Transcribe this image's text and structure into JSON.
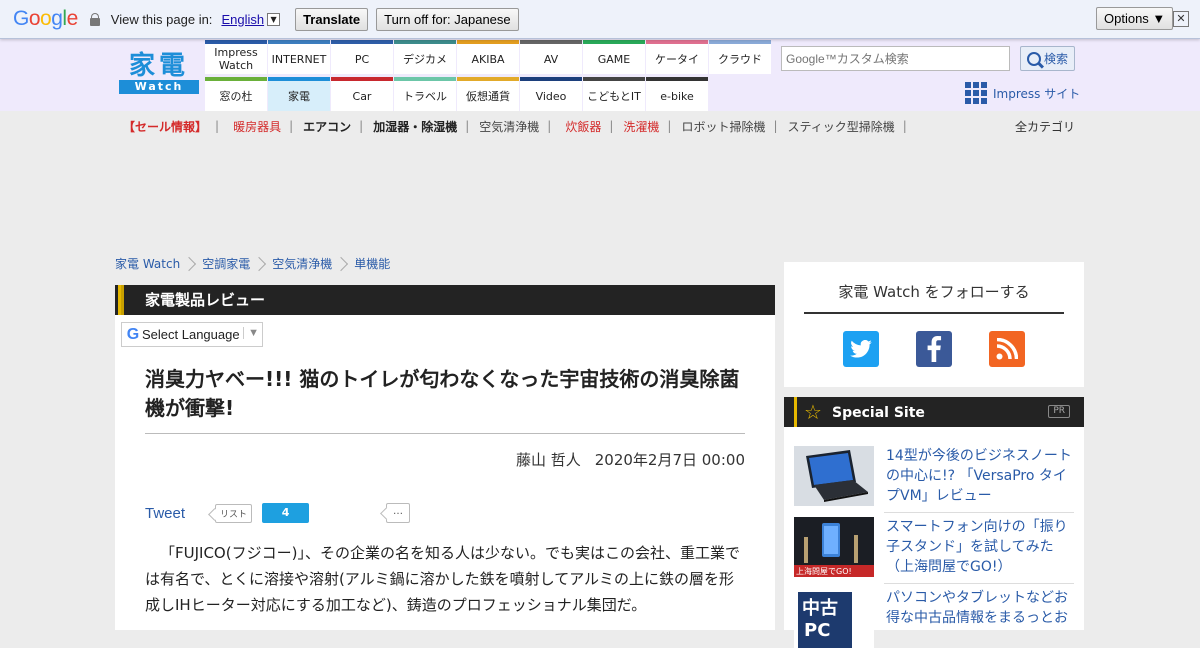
{
  "gtranslate": {
    "view_label": "View this page in:",
    "language": "English",
    "translate_btn": "Translate",
    "turnoff_btn": "Turn off for: Japanese",
    "options_btn": "Options ▼",
    "close": "✕"
  },
  "logo": {
    "kanji": "家電",
    "sub": "Watch"
  },
  "nav": {
    "top": [
      "Impress Watch",
      "INTERNET",
      "PC",
      "デジカメ",
      "AKIBA",
      "AV",
      "GAME",
      "ケータイ",
      "クラウド"
    ],
    "bottom": [
      "窓の杜",
      "家電",
      "Car",
      "トラベル",
      "仮想通貨",
      "Video",
      "こどもとIT",
      "e-bike"
    ]
  },
  "search": {
    "placeholder": "Google™カスタム検索",
    "button": "検索"
  },
  "impress_site": "Impress サイト",
  "categories": [
    {
      "label": "【セール情報】",
      "color": "#d42a2a",
      "bold": true
    },
    {
      "label": "暖房器具",
      "color": "#d42a2a",
      "bold": false
    },
    {
      "label": "エアコン",
      "color": "#222222",
      "bold": true
    },
    {
      "label": "加湿器・除湿機",
      "color": "#222222",
      "bold": true
    },
    {
      "label": "空気清浄機",
      "color": "#444444",
      "bold": false
    },
    {
      "label": "炊飯器",
      "color": "#d42a2a",
      "bold": false
    },
    {
      "label": "洗濯機",
      "color": "#d42a2a",
      "bold": false
    },
    {
      "label": "ロボット掃除機",
      "color": "#444444",
      "bold": false
    },
    {
      "label": "スティック型掃除機",
      "color": "#444444",
      "bold": false
    }
  ],
  "all_categories": "全カテゴリ",
  "breadcrumb": [
    "家電 Watch",
    "空調家電",
    "空気清浄機",
    "単機能"
  ],
  "section_title": "家電製品レビュー",
  "select_language": "Select Language",
  "article": {
    "title": "消臭力ヤベー!!! 猫のトイレが匂わなくなった宇宙技術の消臭除菌機が衝撃!",
    "author": "藤山 哲人",
    "date": "2020年2月7日 00:00",
    "body": "「FUJICO(フジコー)」、その企業の名を知る人は少ない。でも実はこの会社、重工業では有名で、とくに溶接や溶射(アルミ鍋に溶かした鉄を噴射してアルミの上に鉄の層を形成しIHヒーター対応にする加工など)、鋳造のプロフェッショナル集団だ。"
  },
  "share": {
    "tweet": "Tweet",
    "hatebu_label": "リスト",
    "hatebu_count": "4",
    "more": "…"
  },
  "follow": {
    "title": "家電 Watch をフォローする"
  },
  "special": {
    "title": "Special Site",
    "pr": "PR",
    "items": [
      {
        "text": "14型が今後のビジネスノートの中心に!? 「VersaPro タイプVM」レビュー"
      },
      {
        "text": "スマートフォン向けの「振り子スタンド」を試してみた（上海問屋でGO!）"
      },
      {
        "text": "パソコンやタブレットなどお得な中古品情報をまるっとお"
      }
    ]
  },
  "colors": {
    "accent": "#1d8ed8",
    "link": "#2a5ba8",
    "twitter": "#1da1f2",
    "facebook": "#3b5998",
    "rss": "#f26522"
  }
}
